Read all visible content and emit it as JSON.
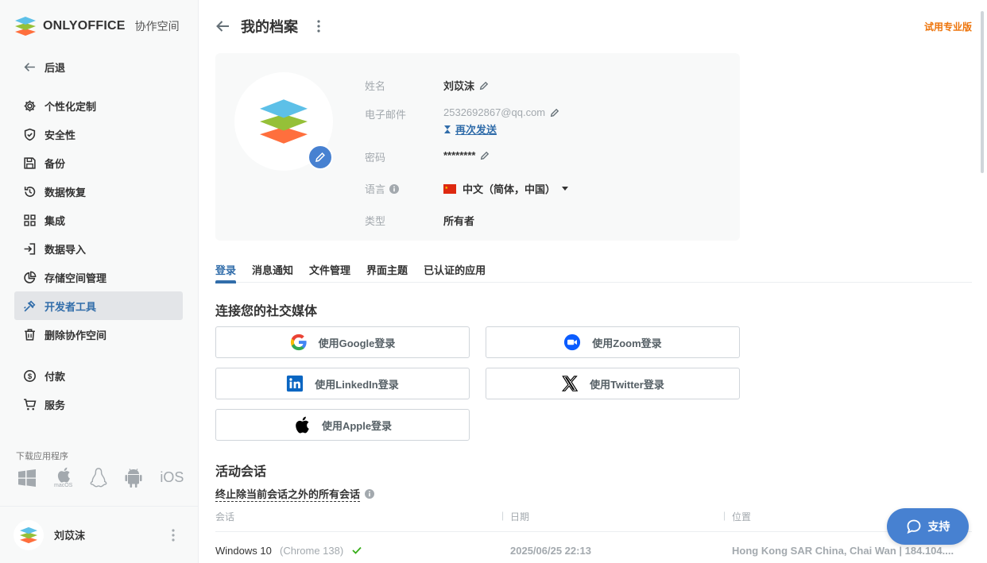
{
  "app": {
    "brand": "ONLYOFFICE",
    "brand_suffix": "协作空间",
    "trial_label": "试用专业版"
  },
  "sidebar": {
    "back_label": "后退",
    "items": [
      {
        "label": "个性化定制",
        "icon": "gear-icon"
      },
      {
        "label": "安全性",
        "icon": "shield-icon"
      },
      {
        "label": "备份",
        "icon": "save-icon"
      },
      {
        "label": "数据恢复",
        "icon": "restore-icon"
      },
      {
        "label": "集成",
        "icon": "grid-icon"
      },
      {
        "label": "数据导入",
        "icon": "import-icon"
      },
      {
        "label": "存储空间管理",
        "icon": "pie-chart-icon"
      },
      {
        "label": "开发者工具",
        "icon": "developer-tools-icon",
        "active": true
      },
      {
        "label": "删除协作空间",
        "icon": "trash-icon"
      }
    ],
    "payment_items": [
      {
        "label": "付款",
        "icon": "dollar-icon"
      },
      {
        "label": "服务",
        "icon": "cart-icon"
      }
    ],
    "download_label": "下载应用程序",
    "downloads": [
      "windows",
      "macOS",
      "linux",
      "android",
      "iOS"
    ],
    "user_name": "刘苡沫"
  },
  "header": {
    "title": "我的档案"
  },
  "profile": {
    "name_label": "姓名",
    "name_value": "刘苡沫",
    "email_label": "电子邮件",
    "email_value": "2532692867@qq.com",
    "resend_label": "再次发送",
    "password_label": "密码",
    "password_value": "********",
    "language_label": "语言",
    "language_value": "中文（简体，中国）",
    "type_label": "类型",
    "type_value": "所有者"
  },
  "tabs": [
    "登录",
    "消息通知",
    "文件管理",
    "界面主题",
    "已认证的应用"
  ],
  "social": {
    "title": "连接您的社交媒体",
    "google": "使用Google登录",
    "zoom": "使用Zoom登录",
    "linkedin": "使用LinkedIn登录",
    "twitter": "使用Twitter登录",
    "apple": "使用Apple登录"
  },
  "sessions": {
    "title": "活动会话",
    "terminate_label": "终止除当前会话之外的所有会话",
    "col_session": "会话",
    "col_date": "日期",
    "col_location": "位置",
    "rows": [
      {
        "os": "Windows 10",
        "browser": "(Chrome 138)",
        "date": "2025/06/25 22:13",
        "location": "Hong Kong SAR China, Chai Wan | 184.104...."
      }
    ]
  },
  "support_label": "支持",
  "colors": {
    "accent": "#316daa",
    "trial": "#ed7309",
    "support": "#4781d1"
  }
}
